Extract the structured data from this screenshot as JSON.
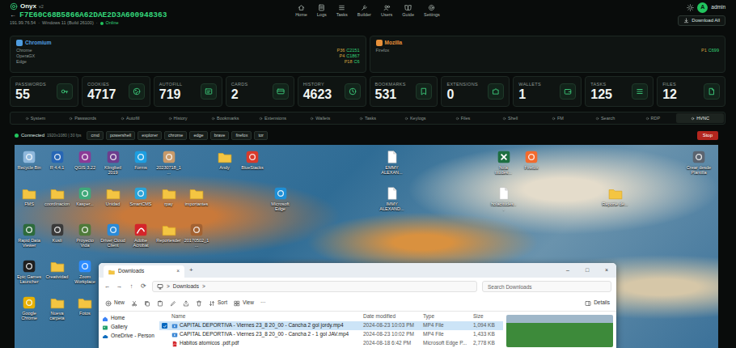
{
  "app": {
    "name": "Onyx",
    "version": "v2"
  },
  "client": {
    "back": "←",
    "id": "F7E60C68B5866A62DAE2D3A600948363",
    "ip": "191.99.76.54",
    "sep": "·",
    "os": "Windows 11 (Build 26100)",
    "status": "Online",
    "online": true
  },
  "nav": [
    {
      "label": "Home",
      "selected": false
    },
    {
      "label": "Logs",
      "selected": false
    },
    {
      "label": "Tasks",
      "selected": false
    },
    {
      "label": "Builder",
      "selected": false
    },
    {
      "label": "Users",
      "selected": false
    },
    {
      "label": "Guide",
      "selected": false
    },
    {
      "label": "Settings",
      "selected": false
    }
  ],
  "user": {
    "avatar": "A",
    "name": "admin"
  },
  "download_all": "Download All",
  "browsers": [
    {
      "title": "Chromium",
      "color": "#4f9de0",
      "items": [
        {
          "name": "Chrome",
          "passwords": "P36",
          "cookies": "C2151"
        },
        {
          "name": "OperaGX",
          "passwords": "P4",
          "cookies": "C1867"
        },
        {
          "name": "Edge",
          "passwords": "P18",
          "cookies": "C6"
        }
      ]
    },
    {
      "title": "Mozilla",
      "color": "#e8913a",
      "items": [
        {
          "name": "Firefox",
          "passwords": "P1",
          "cookies": "C699"
        }
      ]
    }
  ],
  "stats": [
    {
      "label": "PASSWORDS",
      "value": "55"
    },
    {
      "label": "COOKIES",
      "value": "4717"
    },
    {
      "label": "AUTOFILL",
      "value": "719"
    },
    {
      "label": "CARDS",
      "value": "2"
    },
    {
      "label": "HISTORY",
      "value": "4623"
    },
    {
      "label": "BOOKMARKS",
      "value": "531"
    },
    {
      "label": "EXTENSIONS",
      "value": "0"
    },
    {
      "label": "WALLETS",
      "value": "1"
    },
    {
      "label": "TASKS",
      "value": "125"
    },
    {
      "label": "FILES",
      "value": "12"
    }
  ],
  "tabs": [
    {
      "label": "System",
      "selected": false
    },
    {
      "label": "Passwords",
      "selected": false
    },
    {
      "label": "Autofill",
      "selected": false
    },
    {
      "label": "History",
      "selected": false
    },
    {
      "label": "Bookmarks",
      "selected": false
    },
    {
      "label": "Extensions",
      "selected": false
    },
    {
      "label": "Wallets",
      "selected": false
    },
    {
      "label": "Tasks",
      "selected": false
    },
    {
      "label": "Keylogs",
      "selected": false
    },
    {
      "label": "Files",
      "selected": false
    },
    {
      "label": "Shell",
      "selected": false
    },
    {
      "label": "FM",
      "selected": false
    },
    {
      "label": "Search",
      "selected": false
    },
    {
      "label": "RDP",
      "selected": false
    },
    {
      "label": "HVNC",
      "selected": true
    }
  ],
  "hvnc": {
    "status": "Connected",
    "connected": true,
    "info": "1920x1080 | 30 fps",
    "launchers": [
      {
        "label": "cmd"
      },
      {
        "label": "powershell"
      },
      {
        "label": "explorer"
      },
      {
        "label": "chrome"
      },
      {
        "label": "edge"
      },
      {
        "label": "brave"
      },
      {
        "label": "firefox"
      },
      {
        "label": "tor"
      }
    ],
    "stop": "Stop"
  },
  "desktop": {
    "icons": [
      {
        "label": "Recycle Bin",
        "kind": "app",
        "color": "#8fb8dc"
      },
      {
        "label": "R 4.4.1",
        "kind": "app",
        "color": "#2766b5"
      },
      {
        "label": "QGIS 3.22",
        "kind": "app",
        "color": "#8b3a96"
      },
      {
        "label": "Klingbeil 2019",
        "kind": "app",
        "color": "#6d3d8e"
      },
      {
        "label": "Forms",
        "kind": "app",
        "color": "#1d9ee0"
      },
      {
        "label": "20230718_1...",
        "kind": "app",
        "color": "#c79a6a"
      },
      {
        "label": "Andy",
        "kind": "folder"
      },
      {
        "label": "BlueStacks",
        "kind": "app",
        "color": "#d93a2b"
      },
      {
        "label": "EMMY ALEXAN...",
        "kind": "file"
      },
      {
        "label": "hola titudes...",
        "kind": "excel"
      },
      {
        "label": "Firefox",
        "kind": "app",
        "color": "#f26b2e"
      },
      {
        "label": "Crear desde Plantilla",
        "kind": "app",
        "color": "#5b6470"
      },
      {
        "label": "FMS",
        "kind": "folder"
      },
      {
        "label": "coordinacion",
        "kind": "folder"
      },
      {
        "label": "Kasper...",
        "kind": "app",
        "color": "#3fa87a"
      },
      {
        "label": "Unidad",
        "kind": "folder"
      },
      {
        "label": "SmartCMS",
        "kind": "app",
        "color": "#2aa3d8"
      },
      {
        "label": "rpay",
        "kind": "folder"
      },
      {
        "label": "importantes",
        "kind": "folder"
      },
      {
        "label": "Microsoft Edge",
        "kind": "app",
        "color": "#1e8fd6"
      },
      {
        "label": "IMMY ALEXAND...",
        "kind": "file"
      },
      {
        "label": "holacitudes...",
        "kind": "file"
      },
      {
        "label": "Reporte de...",
        "kind": "folder"
      },
      {
        "label": "Rapid Data Viewer",
        "kind": "app",
        "color": "#2d6b3c"
      },
      {
        "label": "Kusli",
        "kind": "app",
        "color": "#3a3a3a"
      },
      {
        "label": "Proyecto Vida",
        "kind": "app",
        "color": "#4f7a3a"
      },
      {
        "label": "Driver Cloud Client",
        "kind": "app",
        "color": "#2a8ad8"
      },
      {
        "label": "Adobe Acrobat",
        "kind": "pdf"
      },
      {
        "label": "Reportesder",
        "kind": "folder"
      },
      {
        "label": "20170502_1...",
        "kind": "app",
        "color": "#a36232"
      },
      {
        "label": "Epic Games Launcher",
        "kind": "app",
        "color": "#1f1f1f"
      },
      {
        "label": "Creatividad",
        "kind": "folder"
      },
      {
        "label": "Zoom Workplace",
        "kind": "app",
        "color": "#2d8cff"
      },
      {
        "label": "Google Chrome",
        "kind": "app",
        "color": "#e8b100"
      },
      {
        "label": "Nueva carpeta",
        "kind": "folder"
      },
      {
        "label": "Fotos",
        "kind": "folder"
      }
    ],
    "explorer": {
      "tab": "Downloads",
      "tab_close": "×",
      "new_tab": "+",
      "controls": [
        "–",
        "□",
        "×"
      ],
      "nav": [
        "←",
        "→",
        "↑",
        "⟳"
      ],
      "crumbs": [
        ">",
        "Downloads",
        ">"
      ],
      "search": {
        "placeholder": "Search Downloads"
      },
      "toolbar": {
        "new": "New",
        "sort": "Sort",
        "view": "View",
        "more": "···",
        "details": "Details"
      },
      "sidebar": [
        {
          "label": "Home",
          "selected": false
        },
        {
          "label": "Gallery",
          "selected": false
        },
        {
          "label": "OneDrive - Person",
          "selected": false
        }
      ],
      "columns": [
        "Name",
        "Date modified",
        "Type",
        "Size"
      ],
      "rows": [
        {
          "name": "CAPITAL DEPORTIVA - Viernes 23_8 20_00 - Cancha 2 gol jordy.mp4",
          "date": "2024-08-23 10:03 PM",
          "type": "MP4 File",
          "size": "1,094 KB",
          "kind": "video",
          "selected": true
        },
        {
          "name": "CAPITAL DEPORTIVA - Viernes 23_8 20_00 - Cancha 2 - 1 gol JAV.mp4",
          "date": "2024-08-23 10:02 PM",
          "type": "MP4 File",
          "size": "1,433 KB",
          "kind": "video",
          "selected": false
        },
        {
          "name": "Habitos atomicos .pdf.pdf",
          "date": "2024-08-18 6:42 PM",
          "type": "Microsoft Edge P...",
          "size": "2,778 KB",
          "kind": "pdf",
          "selected": false
        }
      ]
    }
  }
}
